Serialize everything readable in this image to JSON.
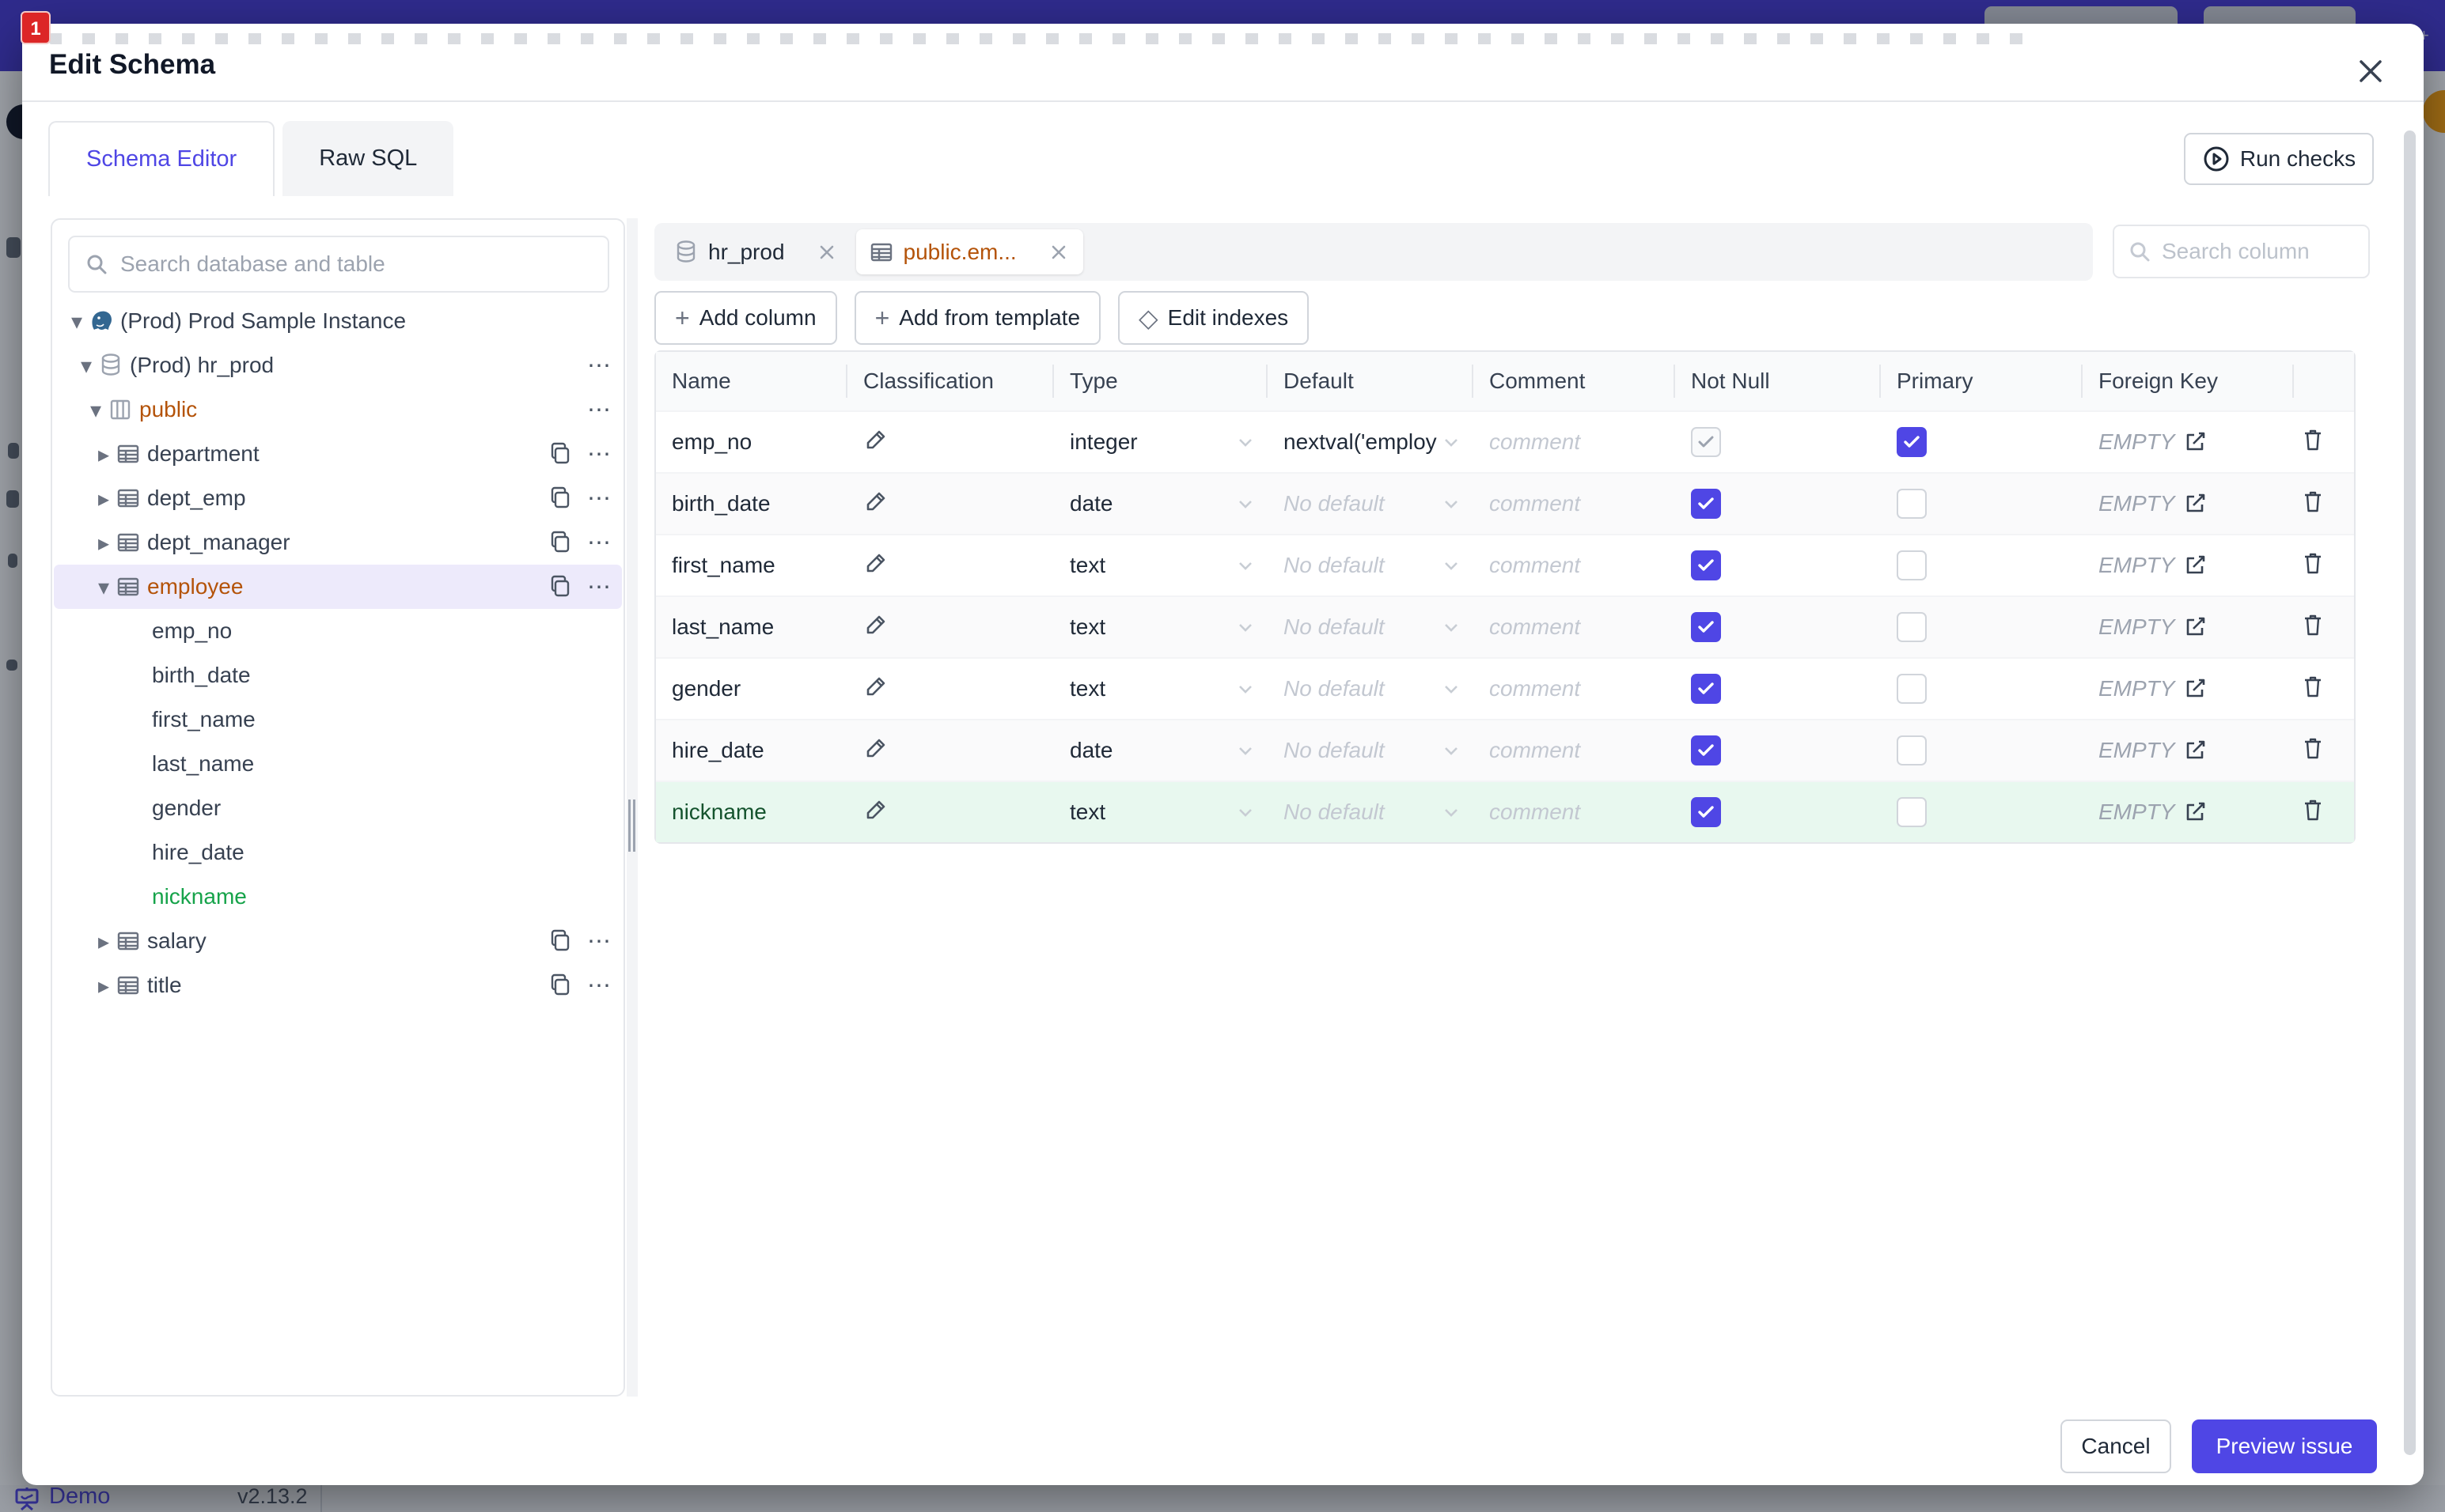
{
  "modal": {
    "title": "Edit Schema"
  },
  "tabs": [
    {
      "label": "Schema Editor",
      "active": true
    },
    {
      "label": "Raw SQL",
      "active": false
    }
  ],
  "run_checks_label": "Run checks",
  "sidebar": {
    "search_placeholder": "Search database and table",
    "tree": [
      {
        "label": "(Prod) Prod Sample Instance",
        "level": 0,
        "icon": "postgres",
        "arrow": "down"
      },
      {
        "label": "(Prod) hr_prod",
        "level": 1,
        "icon": "database",
        "arrow": "down",
        "dots": true
      },
      {
        "label": "public",
        "level": 2,
        "icon": "schema",
        "arrow": "down",
        "dots": true,
        "amber": true
      },
      {
        "label": "department",
        "level": 3,
        "icon": "table",
        "arrow": "right",
        "copy": true,
        "dots": true
      },
      {
        "label": "dept_emp",
        "level": 3,
        "icon": "table",
        "arrow": "right",
        "copy": true,
        "dots": true
      },
      {
        "label": "dept_manager",
        "level": 3,
        "icon": "table",
        "arrow": "right",
        "copy": true,
        "dots": true
      },
      {
        "label": "employee",
        "level": 3,
        "icon": "table",
        "arrow": "down",
        "copy": true,
        "dots": true,
        "amber": true,
        "selected": true
      },
      {
        "label": "emp_no",
        "level": 4
      },
      {
        "label": "birth_date",
        "level": 4
      },
      {
        "label": "first_name",
        "level": 4
      },
      {
        "label": "last_name",
        "level": 4
      },
      {
        "label": "gender",
        "level": 4
      },
      {
        "label": "hire_date",
        "level": 4
      },
      {
        "label": "nickname",
        "level": 4,
        "green": true
      },
      {
        "label": "salary",
        "level": 3,
        "icon": "table",
        "arrow": "right",
        "copy": true,
        "dots": true
      },
      {
        "label": "title",
        "level": 3,
        "icon": "table",
        "arrow": "right",
        "copy": true,
        "dots": true
      }
    ]
  },
  "workspace": {
    "chips": [
      {
        "label": "hr_prod",
        "icon": "database",
        "active": false
      },
      {
        "label": "public.em...",
        "icon": "table",
        "active": true
      }
    ],
    "column_search_placeholder": "Search column",
    "actions": [
      {
        "label": "Add column",
        "glyph": "plus"
      },
      {
        "label": "Add from template",
        "glyph": "plus"
      },
      {
        "label": "Edit indexes",
        "glyph": "diamond"
      }
    ]
  },
  "table": {
    "columns": [
      "Name",
      "Classification",
      "Type",
      "Default",
      "Comment",
      "Not Null",
      "Primary",
      "Foreign Key",
      ""
    ],
    "comment_placeholder": "comment",
    "no_default_placeholder": "No default",
    "fk_empty_label": "EMPTY",
    "rows": [
      {
        "name": "emp_no",
        "type": "integer",
        "default_value": "nextval('employ",
        "has_default": true,
        "not_null": "disabled-checked",
        "primary": "checked"
      },
      {
        "name": "birth_date",
        "type": "date",
        "has_default": false,
        "not_null": "checked",
        "primary": "unchecked",
        "alt": true
      },
      {
        "name": "first_name",
        "type": "text",
        "has_default": false,
        "not_null": "checked",
        "primary": "unchecked"
      },
      {
        "name": "last_name",
        "type": "text",
        "has_default": false,
        "not_null": "checked",
        "primary": "unchecked",
        "alt": true
      },
      {
        "name": "gender",
        "type": "text",
        "has_default": false,
        "not_null": "checked",
        "primary": "unchecked"
      },
      {
        "name": "hire_date",
        "type": "date",
        "has_default": false,
        "not_null": "checked",
        "primary": "unchecked",
        "alt": true
      },
      {
        "name": "nickname",
        "type": "text",
        "has_default": false,
        "not_null": "checked",
        "primary": "unchecked",
        "green": true
      }
    ]
  },
  "footer_buttons": {
    "cancel": "Cancel",
    "primary": "Preview issue"
  },
  "backdrop": {
    "brand": "Demo",
    "version": "v2.13.2",
    "rec_badge": "1"
  },
  "icons": {
    "search": "magnifier",
    "close": "x-mark",
    "run_checks": "play-circle",
    "tree_copy": "copy-duplicate",
    "tree_more": "ellipsis",
    "classification_edit": "pencil",
    "type_dropdown": "chevron-down",
    "fk_edit": "pencil-square",
    "row_delete": "trash",
    "brand": "presentation-board"
  },
  "colors": {
    "accent": "#4F46E5",
    "amber_text": "#B45309",
    "green_text": "#16A34A",
    "green_row_bg": "#E8F8EF",
    "selected_tree_bg": "#EDEAFB",
    "header_bar": "#4338CA",
    "avatar": "#F59E0B"
  }
}
